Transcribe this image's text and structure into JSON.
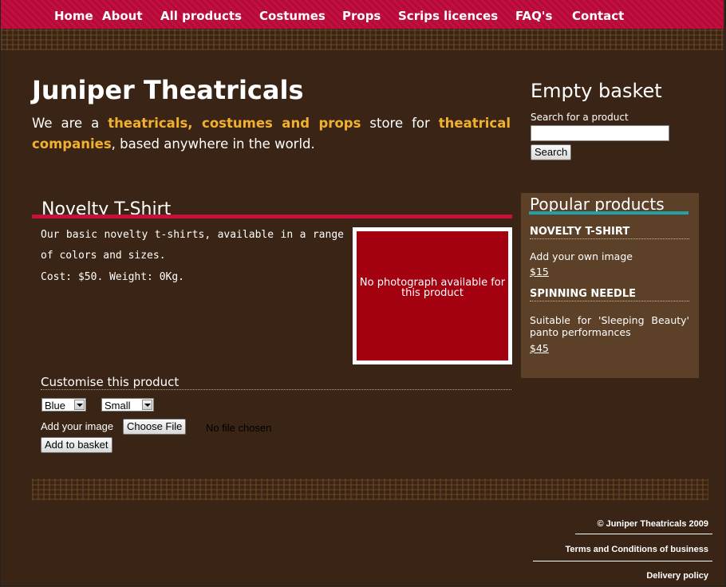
{
  "nav": {
    "items": [
      "Home",
      "About",
      "All products",
      "Costumes",
      "Props",
      "Scrips licences",
      "FAQ's",
      "Contact"
    ]
  },
  "header": {
    "title": "Juniper Theatricals",
    "tagline": {
      "t1": "We are a ",
      "h1": "theatricals, costumes and props",
      "t2": " store for ",
      "h2": "theatrical companies",
      "t3": ", based anywhere in the world."
    }
  },
  "basket": {
    "title": "Empty basket",
    "search_label": "Search for a product",
    "search_value": "",
    "search_button": "Search"
  },
  "product": {
    "title": "Novelty T-Shirt",
    "description": "Our basic novelty t-shirts, available in a range of colors and sizes.",
    "cost": "Cost: $50. Weight: 0Kg.",
    "photo_text": "No photograph available for this product"
  },
  "customise": {
    "title": "Customise this product",
    "color_selected": "Blue",
    "size_selected": "Small",
    "add_image_label": "Add your image",
    "choose_file": "Choose File",
    "no_file": "No file chosen",
    "add_to_basket": "Add to basket"
  },
  "popular": {
    "title": "Popular products",
    "items": [
      {
        "name": "NOVELTY T-SHIRT",
        "desc": "Add your own image",
        "price": "$15"
      },
      {
        "name": "SPINNING NEEDLE",
        "desc": "Suitable for 'Sleeping Beauty' panto performances",
        "price": "$45"
      }
    ]
  },
  "footer": {
    "copyright": "© Juniper Theatricals 2009",
    "terms": "Terms and Conditions of business",
    "delivery": "Delivery policy"
  },
  "colors": {
    "background": "#3a2415",
    "nav": "#c21040",
    "highlight": "#f0b030",
    "photo": "#a30010",
    "sidebar": "#5c4028",
    "accent_teal": "#24a0a8"
  }
}
